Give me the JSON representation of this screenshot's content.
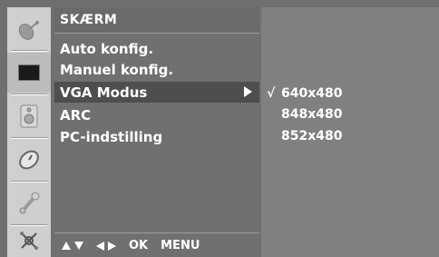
{
  "menu": {
    "title": "SKÆRM",
    "items": [
      {
        "label": "Auto konfig."
      },
      {
        "label": "Manuel konfig."
      },
      {
        "label": "VGA Modus"
      },
      {
        "label": "ARC"
      },
      {
        "label": "PC-indstilling"
      }
    ],
    "selected_index": 2
  },
  "icons": [
    "satellite-icon",
    "screen-icon",
    "speaker-icon",
    "clock-icon",
    "key-icon",
    "tools-icon"
  ],
  "submenu": {
    "items": [
      {
        "label": "640x480",
        "checked": true,
        "check_mark": "√"
      },
      {
        "label": "848x480",
        "checked": false
      },
      {
        "label": "852x480",
        "checked": false
      }
    ]
  },
  "nav_hint": {
    "ok_label": "OK",
    "menu_label": "MENU"
  },
  "colors": {
    "panel": "#707070",
    "selected_row": "#4e4e4e",
    "icon_bar": "#cfcfcf",
    "text": "#ffffff"
  }
}
